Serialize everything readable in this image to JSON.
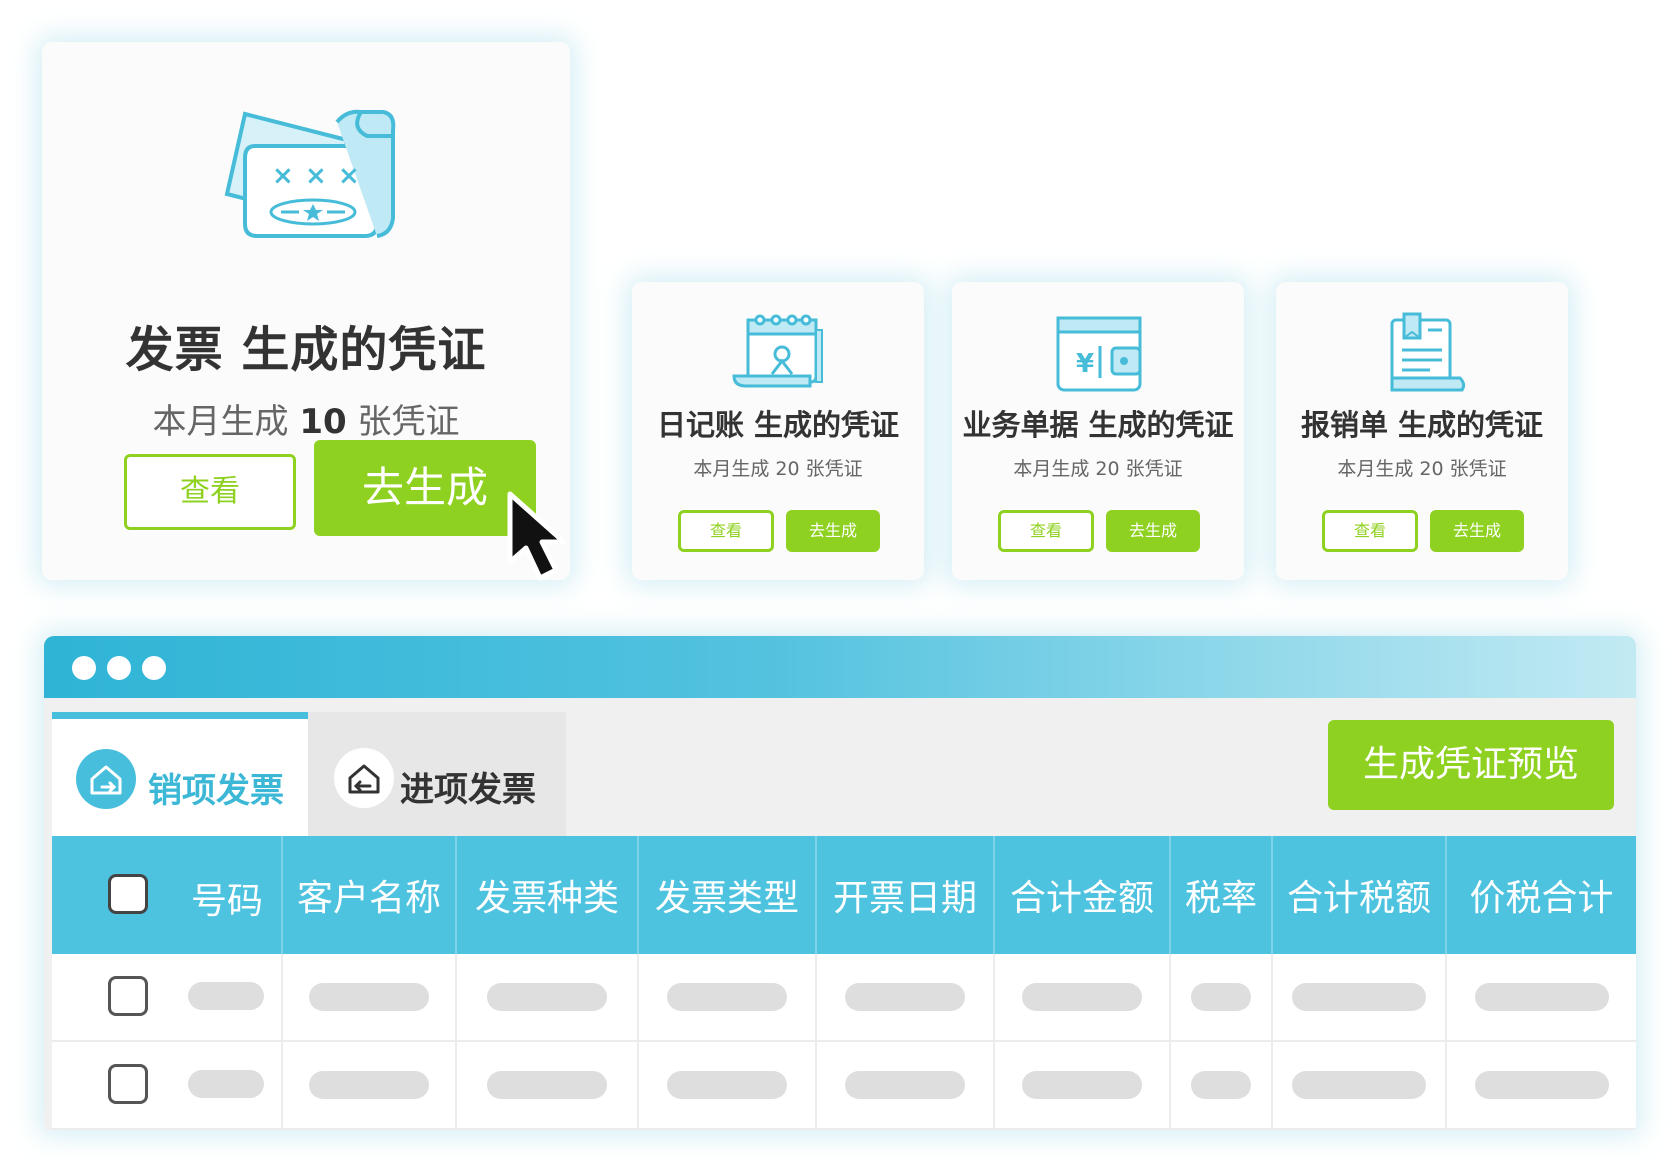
{
  "featured_card": {
    "icon": "invoice-ticket-icon",
    "title": "发票 生成的凭证",
    "count_prefix": "本月生成",
    "count_value": "10",
    "count_suffix": "张凭证",
    "view_label": "查看",
    "generate_label": "去生成"
  },
  "cards": [
    {
      "icon": "calendar-journal-icon",
      "title": "日记账 生成的凭证",
      "count_text": "本月生成 20 张凭证",
      "view_label": "查看",
      "generate_label": "去生成"
    },
    {
      "icon": "wallet-yen-icon",
      "title": "业务单据 生成的凭证",
      "count_text": "本月生成 20 张凭证",
      "view_label": "查看",
      "generate_label": "去生成"
    },
    {
      "icon": "receipt-document-icon",
      "title": "报销单 生成的凭证",
      "count_text": "本月生成 20 张凭证",
      "view_label": "查看",
      "generate_label": "去生成"
    }
  ],
  "window": {
    "tabs": [
      {
        "icon": "house-out-icon",
        "label": "销项发票",
        "active": true
      },
      {
        "icon": "house-in-icon",
        "label": "进项发票",
        "active": false
      }
    ],
    "preview_button_label": "生成凭证预览",
    "table": {
      "columns": [
        "号码",
        "客户名称",
        "发票种类",
        "发票类型",
        "开票日期",
        "合计金额",
        "税率",
        "合计税额",
        "价税合计"
      ],
      "row_count": 2
    }
  },
  "colors": {
    "accent_green": "#8fd120",
    "accent_cyan": "#4ec3df",
    "titlebar_start": "#2fb4d6",
    "titlebar_end": "#c2eaf3"
  }
}
